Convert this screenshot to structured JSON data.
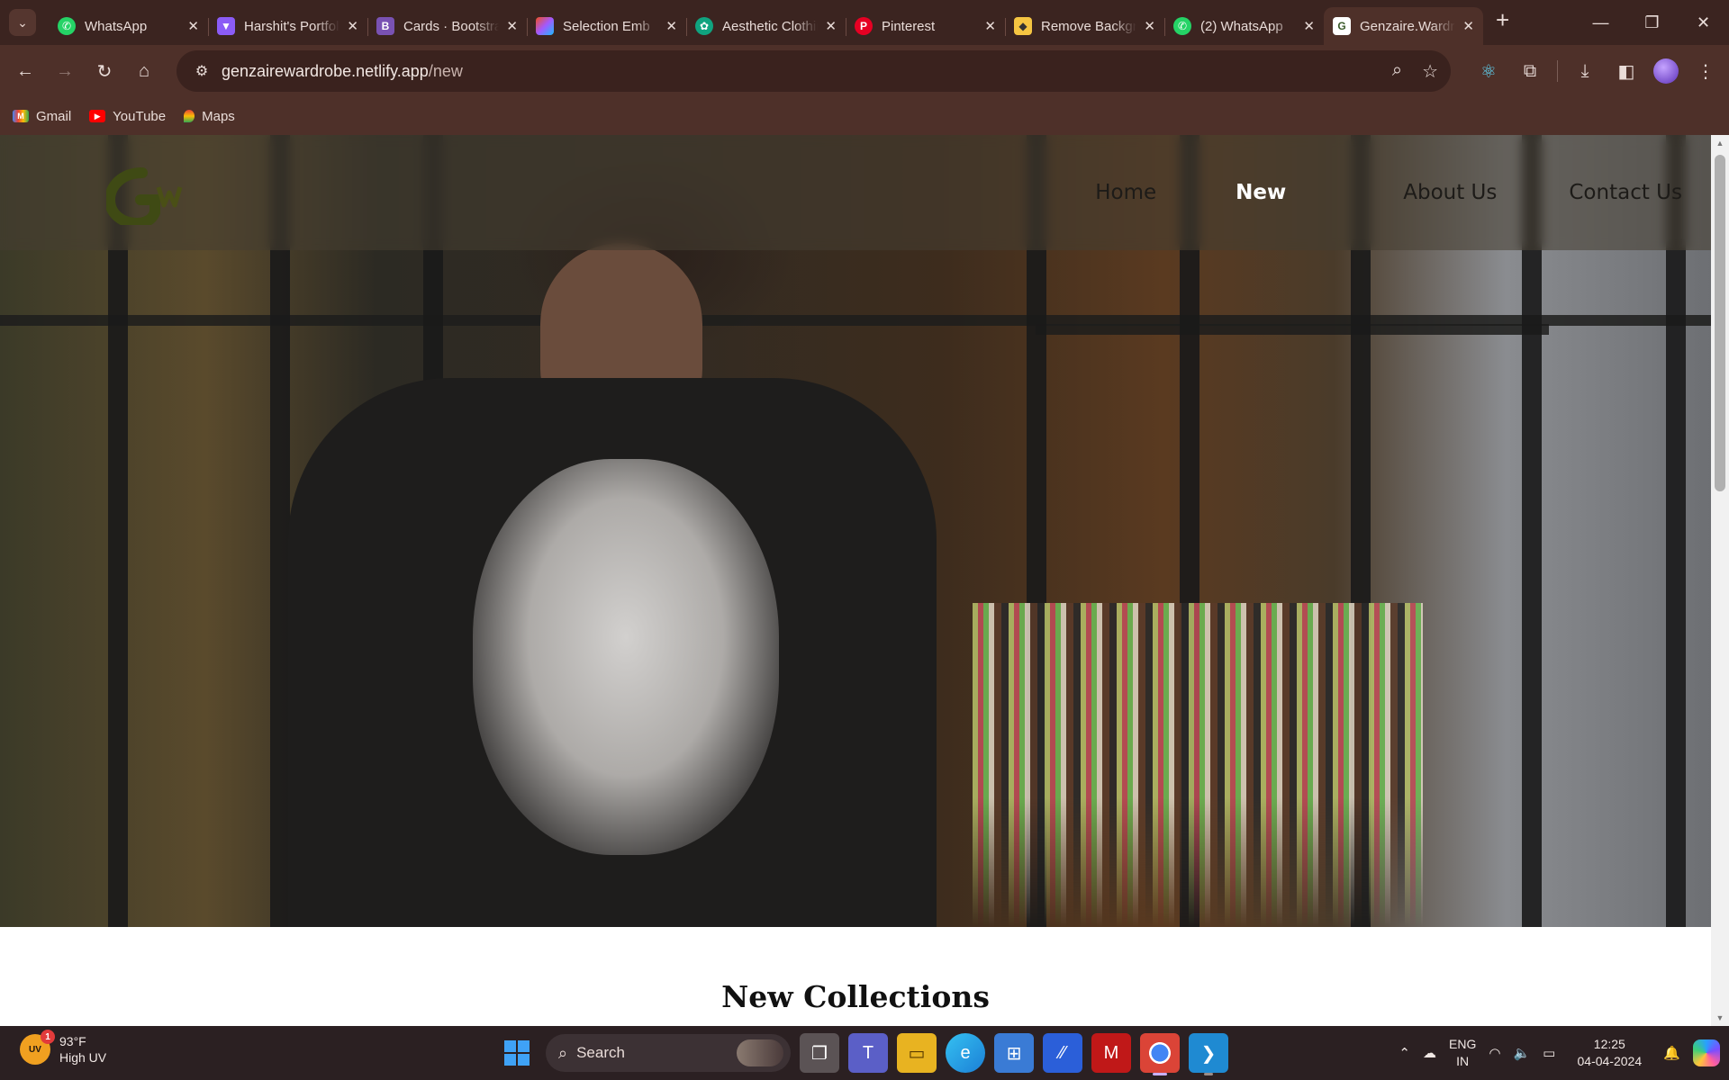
{
  "browser": {
    "tabs": [
      {
        "title": "WhatsApp",
        "favicon": "whatsapp-icon",
        "color": "#25d366"
      },
      {
        "title": "Harshit's Portfolio",
        "favicon": "vite-icon",
        "color": "#8b5cf6"
      },
      {
        "title": "Cards · Bootstrap",
        "favicon": "bootstrap-icon",
        "color": "#7952b3"
      },
      {
        "title": "Selection Emb",
        "favicon": "figma-icon",
        "color": "#f24e1e"
      },
      {
        "title": "Aesthetic Clothing",
        "favicon": "chatgpt-icon",
        "color": "#10a37f"
      },
      {
        "title": "Pinterest",
        "favicon": "pinterest-icon",
        "color": "#e60023"
      },
      {
        "title": "Remove Background",
        "favicon": "removebg-icon",
        "color": "#f5c542"
      },
      {
        "title": "(2) WhatsApp",
        "favicon": "whatsapp-icon",
        "color": "#25d366"
      },
      {
        "title": "Genzaire.Wardrobe",
        "favicon": "genzaire-icon",
        "color": "#ffffff",
        "active": true
      }
    ],
    "url_host": "genzairewardrobe.netlify.app",
    "url_path": "/new",
    "bookmarks": [
      {
        "label": "Gmail",
        "icon": "gmail-icon"
      },
      {
        "label": "YouTube",
        "icon": "youtube-icon"
      },
      {
        "label": "Maps",
        "icon": "maps-icon"
      }
    ]
  },
  "site": {
    "nav": [
      {
        "label": "Home",
        "active": false
      },
      {
        "label": "New",
        "active": true
      },
      {
        "label": "About Us",
        "active": false
      },
      {
        "label": "Contact Us",
        "active": false
      }
    ],
    "section_title": "New Collections"
  },
  "taskbar": {
    "weather_temp": "93°F",
    "weather_desc": "High UV",
    "weather_badge": "1",
    "uv_label": "UV",
    "search_label": "Search",
    "lang_line1": "ENG",
    "lang_line2": "IN",
    "time": "12:25",
    "date": "04-04-2024"
  },
  "colors": {
    "chrome_bg": "#3b2420",
    "toolbar_bg": "#4e3029",
    "nav_active": "#ffffff",
    "taskbar_bg": "#2b2022"
  }
}
